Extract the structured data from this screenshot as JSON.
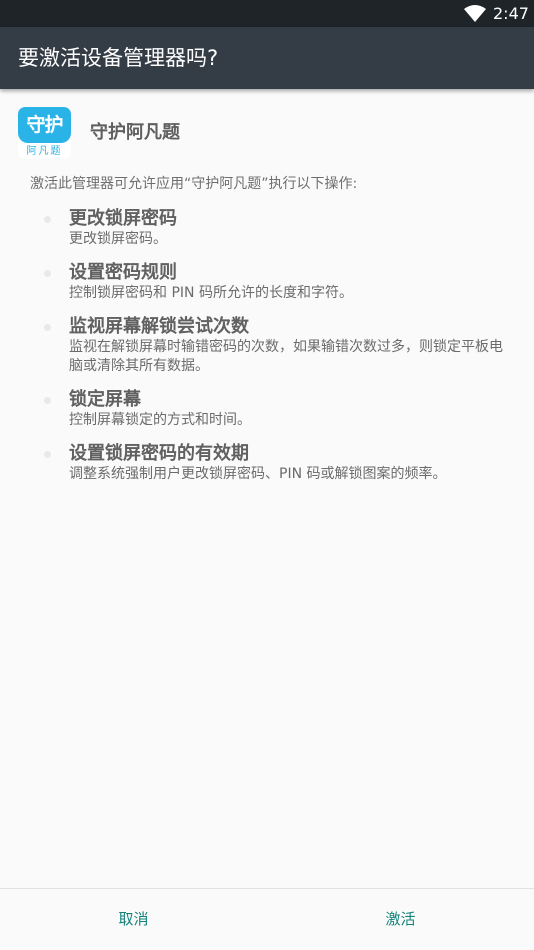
{
  "status_bar": {
    "time": "2:47",
    "wifi_icon": "wifi-icon"
  },
  "dialog": {
    "title": "要激活设备管理器吗?"
  },
  "app": {
    "name": "守护阿凡题",
    "logo_text_top": "守护",
    "logo_text_bottom": "阿凡题"
  },
  "intro": "激活此管理器可允许应用“守护阿凡题”执行以下操作:",
  "policies": [
    {
      "title": "更改锁屏密码",
      "desc": "更改锁屏密码。"
    },
    {
      "title": "设置密码规则",
      "desc": "控制锁屏密码和 PIN 码所允许的长度和字符。"
    },
    {
      "title": "监视屏幕解锁尝试次数",
      "desc": "监视在解锁屏幕时输错密码的次数，如果输错次数过多，则锁定平板电脑或清除其所有数据。"
    },
    {
      "title": "锁定屏幕",
      "desc": "控制屏幕锁定的方式和时间。"
    },
    {
      "title": "设置锁屏密码的有效期",
      "desc": "调整系统强制用户更改锁屏密码、PIN 码或解锁图案的频率。"
    }
  ],
  "actions": {
    "cancel_label": "取消",
    "activate_label": "激活"
  },
  "colors": {
    "accent": "#13837a",
    "app_bar": "#343d46",
    "status_bar": "#1f2429",
    "logo_blue": "#29b3e6"
  }
}
